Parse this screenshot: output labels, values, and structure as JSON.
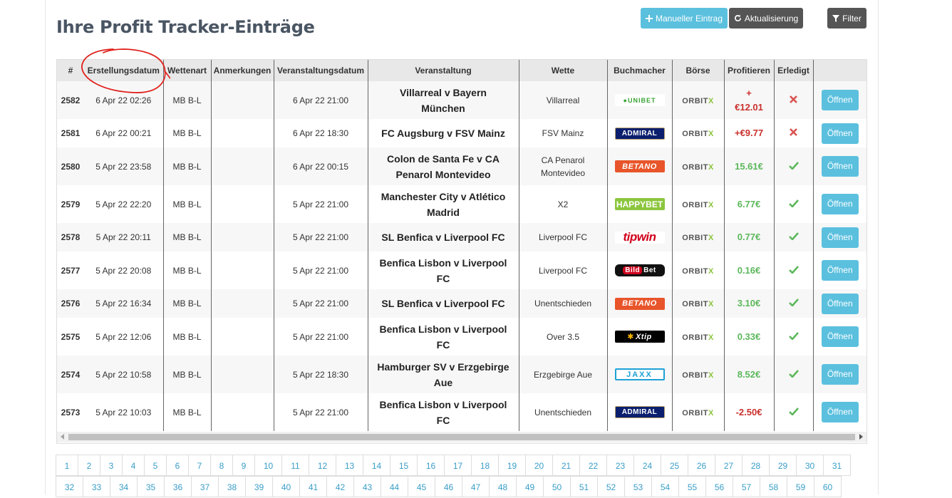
{
  "page_title": "Ihre Profit Tracker-Einträge",
  "toolbar": {
    "manual_label": "Manueller Eintrag",
    "refresh_label": "Aktualisierung",
    "filter_label": "Filter"
  },
  "table": {
    "headers": [
      "#",
      "Erstellungsdatum",
      "Wettenart",
      "Anmerkungen",
      "Veranstaltungsdatum",
      "Veranstaltung",
      "Wette",
      "Buchmacher",
      "Börse",
      "Profitieren",
      "Erledigt",
      ""
    ],
    "open_label": "Öffnen",
    "rows": [
      {
        "id": "2582",
        "created": "6 Apr 22 02:26",
        "type": "MB B-L",
        "notes": "",
        "event_date": "6 Apr 22 21:00",
        "event_l1": "Villarreal v Bayern",
        "event_l2": "München",
        "bet_l1": "Villarreal",
        "bet_l2": "",
        "bookmaker": "unibet",
        "logo_text": "UNIBET",
        "exchange_a": "ORBIT",
        "exchange_b": "X",
        "profit_l1": "+",
        "profit_l2": "€12.01",
        "profit_sign": "neg",
        "done": "no"
      },
      {
        "id": "2581",
        "created": "6 Apr 22 00:21",
        "type": "MB B-L",
        "notes": "",
        "event_date": "6 Apr 22 18:30",
        "event_l1": "FC Augsburg v FSV Mainz",
        "event_l2": "",
        "bet_l1": "FSV Mainz",
        "bet_l2": "",
        "bookmaker": "admiral",
        "logo_text": "ADMIRAL",
        "exchange_a": "ORBIT",
        "exchange_b": "X",
        "profit_l1": "+€9.77",
        "profit_l2": "",
        "profit_sign": "neg",
        "done": "no"
      },
      {
        "id": "2580",
        "created": "5 Apr 22 23:58",
        "type": "MB B-L",
        "notes": "",
        "event_date": "6 Apr 22 00:15",
        "event_l1": "Colon de Santa Fe v CA",
        "event_l2": "Penarol Montevideo",
        "bet_l1": "CA Penarol",
        "bet_l2": "Montevideo",
        "bookmaker": "betano",
        "logo_text": "BETANO",
        "exchange_a": "ORBIT",
        "exchange_b": "X",
        "profit_l1": "15.61€",
        "profit_l2": "",
        "profit_sign": "pos",
        "done": "yes"
      },
      {
        "id": "2579",
        "created": "5 Apr 22 22:20",
        "type": "MB B-L",
        "notes": "",
        "event_date": "5 Apr 22 21:00",
        "event_l1": "Manchester City v Atlético",
        "event_l2": "Madrid",
        "bet_l1": "X2",
        "bet_l2": "",
        "bookmaker": "happybet",
        "logo_text": "HAPPYBET",
        "exchange_a": "ORBIT",
        "exchange_b": "X",
        "profit_l1": "6.77€",
        "profit_l2": "",
        "profit_sign": "pos",
        "done": "yes"
      },
      {
        "id": "2578",
        "created": "5 Apr 22 20:11",
        "type": "MB B-L",
        "notes": "",
        "event_date": "5 Apr 22 21:00",
        "event_l1": "SL Benfica v Liverpool FC",
        "event_l2": "",
        "bet_l1": "Liverpool FC",
        "bet_l2": "",
        "bookmaker": "tipwin",
        "logo_text": "tipwin",
        "exchange_a": "ORBIT",
        "exchange_b": "X",
        "profit_l1": "0.77€",
        "profit_l2": "",
        "profit_sign": "pos",
        "done": "yes"
      },
      {
        "id": "2577",
        "created": "5 Apr 22 20:08",
        "type": "MB B-L",
        "notes": "",
        "event_date": "5 Apr 22 21:00",
        "event_l1": "Benfica Lisbon v Liverpool",
        "event_l2": "FC",
        "bet_l1": "Liverpool FC",
        "bet_l2": "",
        "bookmaker": "bildbet",
        "logo_text": "Bet",
        "logo_text_a": "Bild",
        "exchange_a": "ORBIT",
        "exchange_b": "X",
        "profit_l1": "0.16€",
        "profit_l2": "",
        "profit_sign": "pos",
        "done": "yes"
      },
      {
        "id": "2576",
        "created": "5 Apr 22 16:34",
        "type": "MB B-L",
        "notes": "",
        "event_date": "5 Apr 22 21:00",
        "event_l1": "SL Benfica v Liverpool FC",
        "event_l2": "",
        "bet_l1": "Unentschieden",
        "bet_l2": "",
        "bookmaker": "betano",
        "logo_text": "BETANO",
        "exchange_a": "ORBIT",
        "exchange_b": "X",
        "profit_l1": "3.10€",
        "profit_l2": "",
        "profit_sign": "pos",
        "done": "yes"
      },
      {
        "id": "2575",
        "created": "5 Apr 22 12:06",
        "type": "MB B-L",
        "notes": "",
        "event_date": "5 Apr 22 21:00",
        "event_l1": "Benfica Lisbon v Liverpool",
        "event_l2": "FC",
        "bet_l1": "Over 3.5",
        "bet_l2": "",
        "bookmaker": "xtip",
        "logo_text": "Xtip",
        "exchange_a": "ORBIT",
        "exchange_b": "X",
        "profit_l1": "0.33€",
        "profit_l2": "",
        "profit_sign": "pos",
        "done": "yes"
      },
      {
        "id": "2574",
        "created": "5 Apr 22 10:58",
        "type": "MB B-L",
        "notes": "",
        "event_date": "5 Apr 22 18:30",
        "event_l1": "Hamburger SV v Erzgebirge",
        "event_l2": "Aue",
        "bet_l1": "Erzgebirge Aue",
        "bet_l2": "",
        "bookmaker": "jaxx",
        "logo_text": "JAXX",
        "exchange_a": "ORBIT",
        "exchange_b": "X",
        "profit_l1": "8.52€",
        "profit_l2": "",
        "profit_sign": "pos",
        "done": "yes"
      },
      {
        "id": "2573",
        "created": "5 Apr 22 10:03",
        "type": "MB B-L",
        "notes": "",
        "event_date": "5 Apr 22 21:00",
        "event_l1": "Benfica Lisbon v Liverpool",
        "event_l2": "FC",
        "bet_l1": "Unentschieden",
        "bet_l2": "",
        "bookmaker": "admiral",
        "logo_text": "ADMIRAL",
        "exchange_a": "ORBIT",
        "exchange_b": "X",
        "profit_l1": "-2.50€",
        "profit_l2": "",
        "profit_sign": "neg",
        "done": "yes"
      }
    ]
  },
  "pagination": {
    "row1": [
      "1",
      "2",
      "3",
      "4",
      "5",
      "6",
      "7",
      "8",
      "9",
      "10",
      "11",
      "12",
      "13",
      "14",
      "15",
      "16",
      "17",
      "18",
      "19",
      "20",
      "21",
      "22",
      "23",
      "24",
      "25",
      "26",
      "27",
      "28",
      "29",
      "30",
      "31"
    ],
    "row2": [
      "32",
      "33",
      "34",
      "35",
      "36",
      "37",
      "38",
      "39",
      "40",
      "41",
      "42",
      "43",
      "44",
      "45",
      "46",
      "47",
      "48",
      "49",
      "50",
      "51",
      "52",
      "53",
      "54",
      "55",
      "56",
      "57",
      "58",
      "59",
      "60"
    ]
  },
  "colors": {
    "info": "#5bc0de",
    "dark": "#555555",
    "positive": "#5cb85c",
    "negative": "#c9302c",
    "annotation": "#e0201b"
  }
}
